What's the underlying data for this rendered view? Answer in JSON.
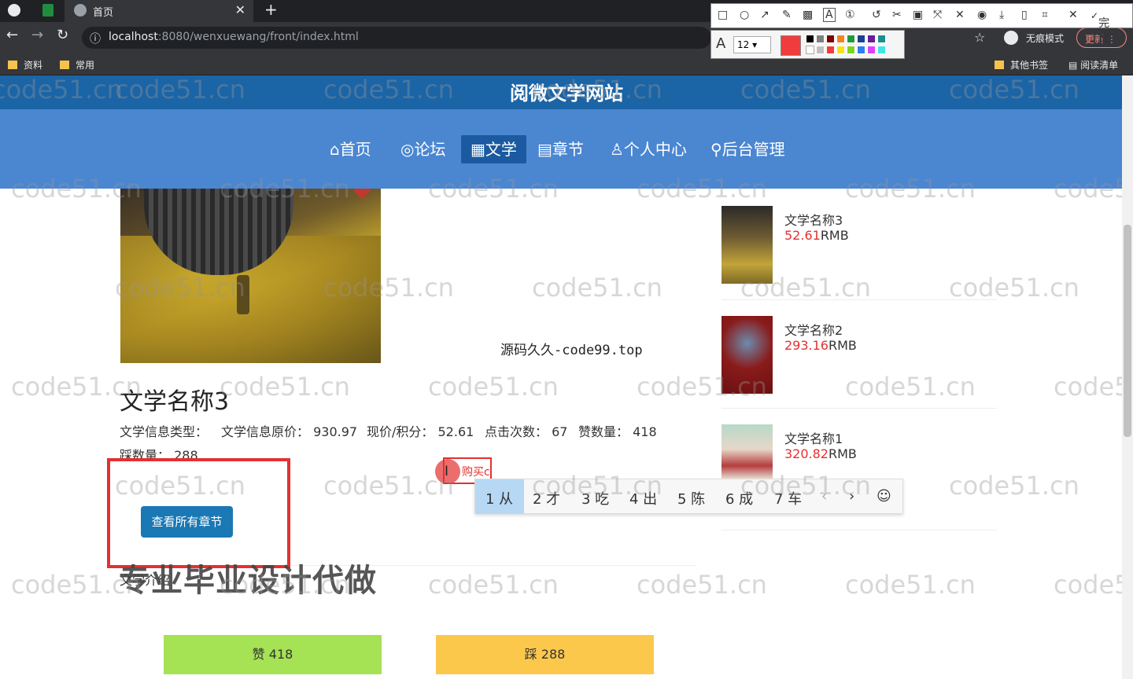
{
  "browser": {
    "tab_title": "首页",
    "url_host": "localhost",
    "url_rest": ":8080/wenxuewang/front/index.html",
    "bookmarks": [
      "资料",
      "常用"
    ],
    "bookmarks_right": [
      "其他书签",
      "阅读清单"
    ],
    "profile_label": "无痕模式",
    "update_label": "更新"
  },
  "screenshot_tool": {
    "done_label": "完成",
    "font_size": "12"
  },
  "site": {
    "title": "阅微文学网站",
    "nav": [
      "⌂首页",
      "◎论坛",
      "▦文学",
      "▤章节",
      "♙个人中心",
      "⚲后台管理"
    ],
    "active_nav": "▦文学"
  },
  "book": {
    "name": "文学名称3",
    "type_label": "文学信息类型：",
    "orig_price_label": "文学信息原价：",
    "orig_price": "930.97",
    "price_label": "现价/积分：",
    "price": "52.61",
    "clicks_label": "点击次数：",
    "clicks": "67",
    "likes_label": "赞数量：",
    "likes": "418",
    "dislikes_label": "踩数量：",
    "dislikes": "288",
    "view_chapters": "查看所有章节",
    "intro_label": "文学介绍",
    "buy_text": "购买c",
    "like_btn": "赞  418",
    "dislike_btn": "踩  288"
  },
  "overlay": {
    "source_mark": "源码久久-code99.top",
    "promo": "专业毕业设计代做",
    "watermark": "code51.cn"
  },
  "ime": {
    "candidates": [
      "1 从",
      "2 才",
      "3 吃",
      "4 出",
      "5 陈",
      "6 成",
      "7 车"
    ],
    "prev": "‹",
    "next": "›",
    "emoji": "☺"
  },
  "sidebar": [
    {
      "name": "文学名称3",
      "price": "52.61",
      "unit": "RMB"
    },
    {
      "name": "文学名称2",
      "price": "293.16",
      "unit": "RMB"
    },
    {
      "name": "文学名称1",
      "price": "320.82",
      "unit": "RMB"
    }
  ]
}
